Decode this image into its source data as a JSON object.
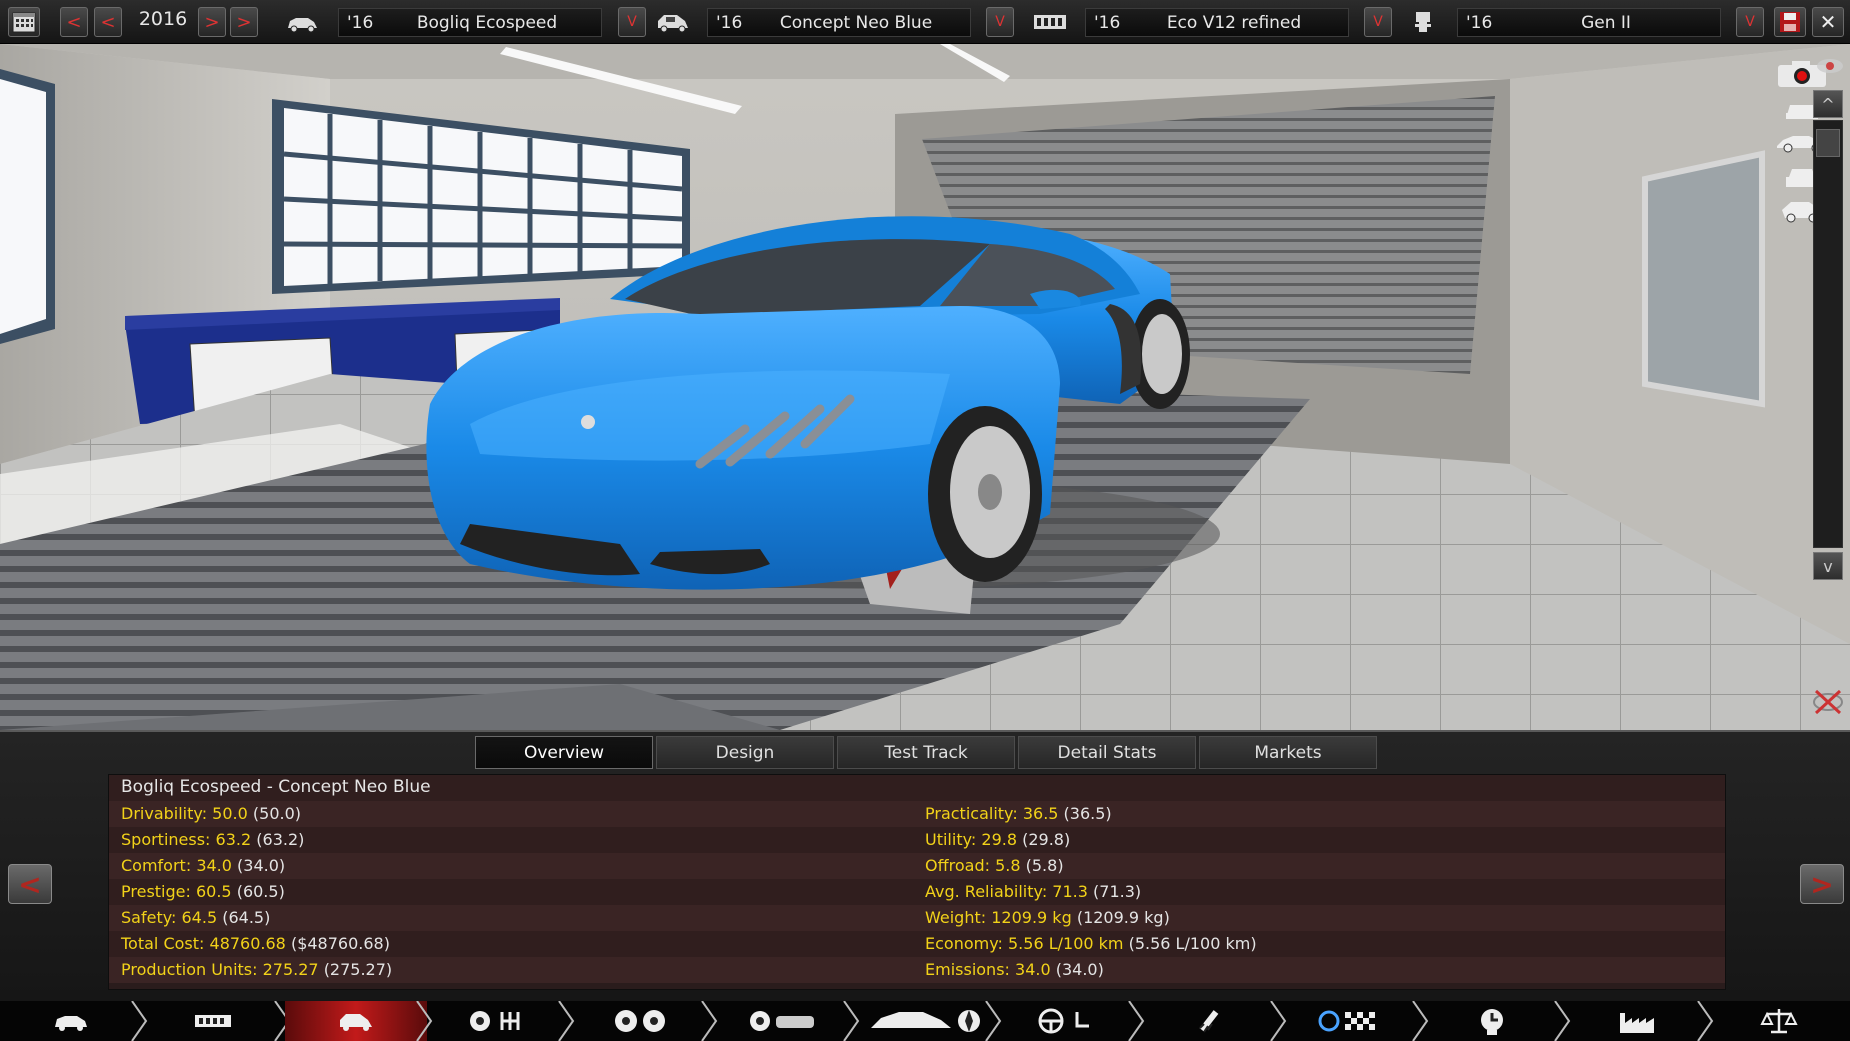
{
  "topbar": {
    "year": "2016",
    "selectors": [
      {
        "year": "'16",
        "name": "Bogliq Ecospeed"
      },
      {
        "year": "'16",
        "name": "Concept Neo Blue"
      },
      {
        "year": "'16",
        "name": "Eco V12 refined"
      },
      {
        "year": "'16",
        "name": "Gen II"
      }
    ],
    "dropdown_label": "V",
    "nav_prev": "<",
    "nav_next": ">"
  },
  "tabs": [
    {
      "label": "Overview",
      "active": true
    },
    {
      "label": "Design",
      "active": false
    },
    {
      "label": "Test Track",
      "active": false
    },
    {
      "label": "Detail Stats",
      "active": false
    },
    {
      "label": "Markets",
      "active": false
    }
  ],
  "overview": {
    "title": "Bogliq Ecospeed - Concept Neo Blue",
    "left": [
      {
        "key": "Drivability:",
        "value": "50.0",
        "paren": "(50.0)"
      },
      {
        "key": "Sportiness:",
        "value": "63.2",
        "paren": "(63.2)"
      },
      {
        "key": "Comfort:",
        "value": "34.0",
        "paren": "(34.0)"
      },
      {
        "key": "Prestige:",
        "value": "60.5",
        "paren": "(60.5)"
      },
      {
        "key": "Safety:",
        "value": "64.5",
        "paren": "(64.5)"
      },
      {
        "key": "Total Cost:",
        "value": "48760.68",
        "paren": "($48760.68)"
      },
      {
        "key": "Production Units:",
        "value": "275.27",
        "paren": "(275.27)"
      }
    ],
    "right": [
      {
        "key": "Practicality:",
        "value": "36.5",
        "paren": "(36.5)"
      },
      {
        "key": "Utility:",
        "value": "29.8",
        "paren": "(29.8)"
      },
      {
        "key": "Offroad:",
        "value": "5.8",
        "paren": "(5.8)"
      },
      {
        "key": "Avg. Reliability:",
        "value": "71.3",
        "paren": "(71.3)"
      },
      {
        "key": "Weight:",
        "value": "1209.9 kg",
        "paren": "(1209.9 kg)"
      },
      {
        "key": "Economy:",
        "value": "5.56 L/100 km",
        "paren": "(5.56 L/100 km)"
      },
      {
        "key": "Emissions:",
        "value": "34.0",
        "paren": "(34.0)"
      }
    ]
  },
  "panel_nav": {
    "prev": "<",
    "next": ">"
  },
  "side_controls": {
    "up": "^",
    "down": "v"
  },
  "colors": {
    "car": "#1f8fe6",
    "stat_value": "#f2d219",
    "active_nav": "#c21a1a"
  }
}
